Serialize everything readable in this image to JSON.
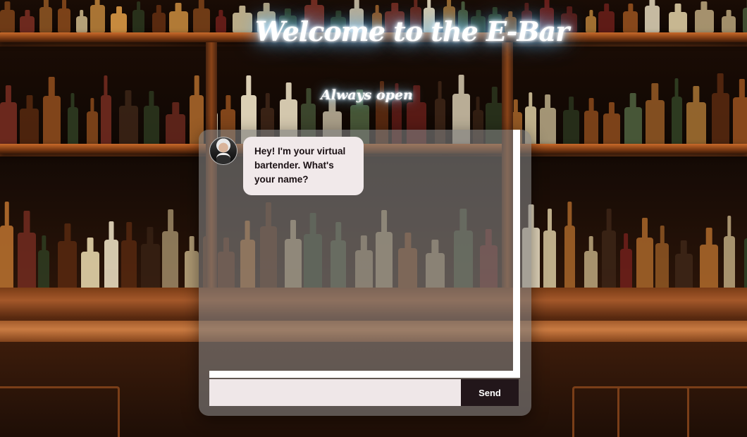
{
  "signage": {
    "title": "Welcome to the E-Bar",
    "subtitle": "Always open"
  },
  "chat": {
    "bot_avatar": "bartender-avatar",
    "messages": [
      {
        "sender": "bot",
        "text": "Hey! I'm your virtual bartender. What's your name?"
      }
    ],
    "input": {
      "value": "",
      "placeholder": ""
    },
    "send_label": "Send"
  },
  "colors": {
    "bubble_bg": "#f1e9ea",
    "send_bg": "#22161a",
    "panel_bg": "rgba(128,128,128,0.62)",
    "neon_glow": "#7ac8ff"
  }
}
